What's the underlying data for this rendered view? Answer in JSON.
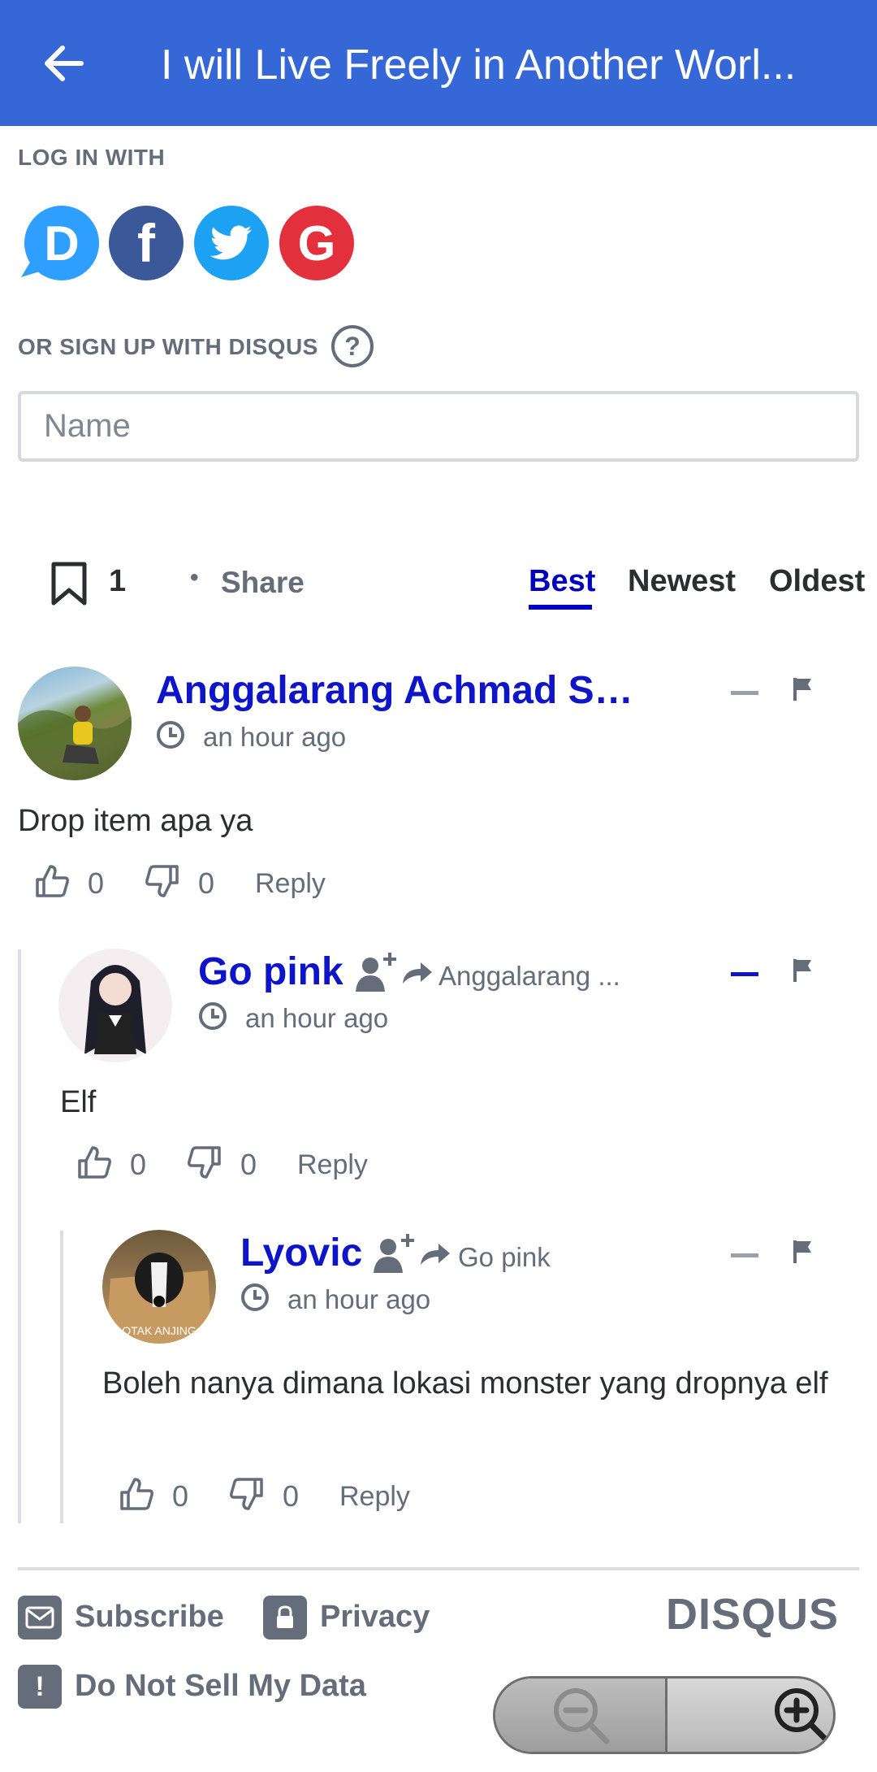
{
  "appbar": {
    "title": "I will Live Freely in Another Worl..."
  },
  "login": {
    "label": "LOG IN WITH",
    "providers": [
      {
        "name": "Disqus",
        "letter": "D",
        "color": "#2e9fff"
      },
      {
        "name": "Facebook",
        "letter": "f",
        "color": "#3b5998"
      },
      {
        "name": "Twitter",
        "color": "#1da1f2"
      },
      {
        "name": "Google",
        "letter": "G",
        "color": "#e2303d"
      }
    ],
    "signup_label": "OR SIGN UP WITH DISQUS",
    "help": "?",
    "name_placeholder": "Name"
  },
  "toolbar": {
    "bookmark_count": "1",
    "bullet": "•",
    "share": "Share",
    "tabs": [
      "Best",
      "Newest",
      "Oldest"
    ],
    "active_tab": "Best",
    "accent": "#0000c0"
  },
  "comments": [
    {
      "author": "Anggalarang Achmad Sal...",
      "time": "an hour ago",
      "text": "Drop item apa ya",
      "upvotes": "0",
      "downvotes": "0",
      "reply": "Reply"
    },
    {
      "author": "Go pink",
      "reply_to": "Anggalarang ...",
      "time": "an hour ago",
      "text": "Elf",
      "upvotes": "0",
      "downvotes": "0",
      "reply": "Reply"
    },
    {
      "author": "Lyovic",
      "reply_to": "Go pink",
      "avatar_caption": "OTAK ANJING",
      "time": "an hour ago",
      "text": "Boleh nanya dimana lokasi monster yang dropnya elf",
      "upvotes": "0",
      "downvotes": "0",
      "reply": "Reply"
    }
  ],
  "footer": {
    "subscribe": "Subscribe",
    "privacy": "Privacy",
    "do_not_sell": "Do Not Sell My Data",
    "logo": "DISQUS"
  },
  "colors": {
    "appbar": "#3567d6",
    "author": "#0e14c8",
    "muted": "#656c7a"
  }
}
